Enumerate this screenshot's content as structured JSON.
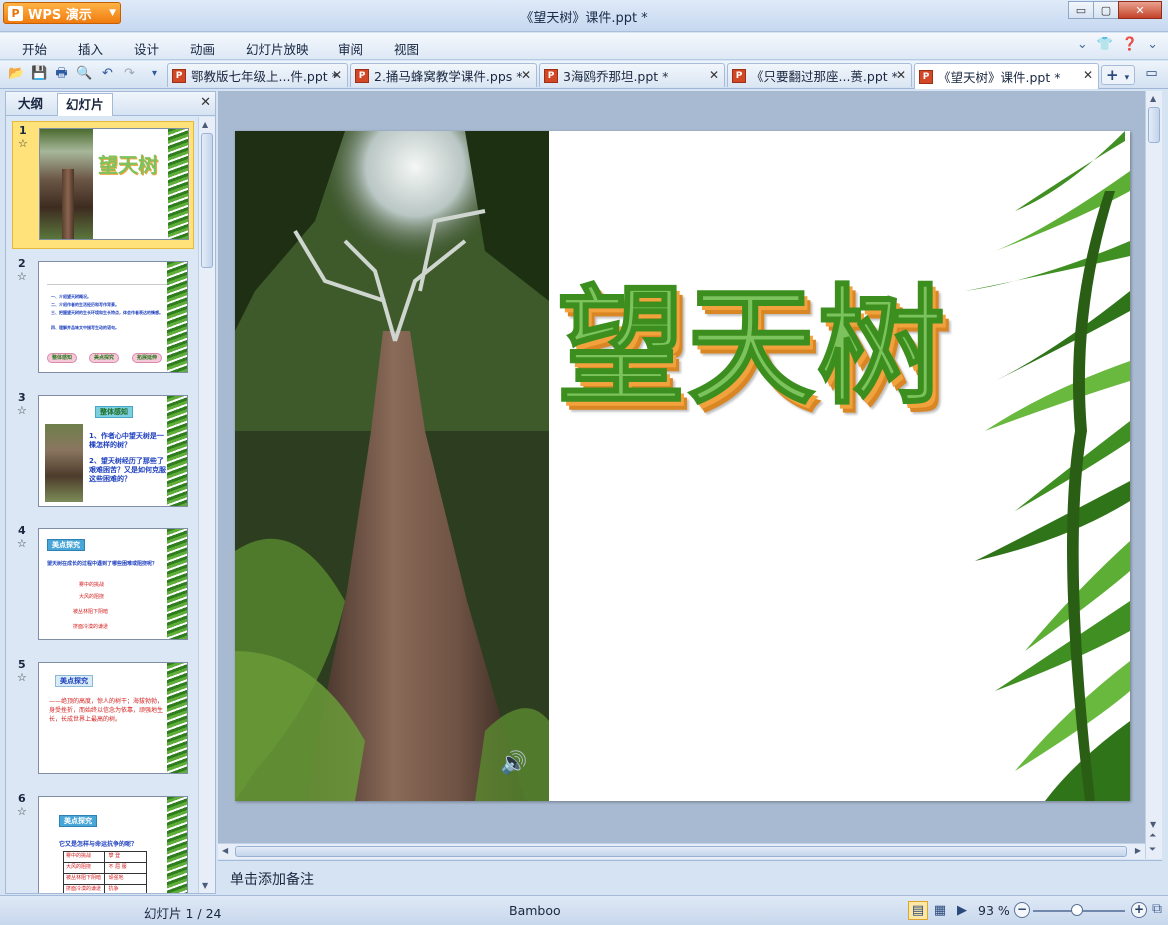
{
  "app": {
    "button_label": "WPS 演示",
    "window_title": "《望天树》课件.ppt *"
  },
  "window_controls": {
    "minimize": "▭",
    "maximize": "▢",
    "close": "✕"
  },
  "menu": [
    "开始",
    "插入",
    "设计",
    "动画",
    "幻灯片放映",
    "审阅",
    "视图"
  ],
  "tabs": [
    {
      "label": "鄂教版七年级上...件.ppt *"
    },
    {
      "label": "2.捅马蜂窝教学课件.pps *"
    },
    {
      "label": "3海鸥乔那坦.ppt *"
    },
    {
      "label": "《只要翻过那座...蒉.ppt *"
    },
    {
      "label": "《望天树》课件.ppt *"
    }
  ],
  "panel": {
    "tab_outline": "大纲",
    "tab_slides": "幻灯片"
  },
  "thumbnails": [
    {
      "num": "1",
      "title": "望天树"
    },
    {
      "num": "2",
      "buttons": [
        "整体感知",
        "美点探究",
        "拓展延伸"
      ],
      "lines": [
        "一、介绍望天树概况。",
        "二、介绍作者的生活经历和写作背景。",
        "三、把握望天树的生长环境和生长特点，体会作者表达的情感。",
        "四、理解并品味文中描写生动的语句。"
      ]
    },
    {
      "num": "3",
      "tag": "整体感知",
      "lines": [
        "1、作者心中望天树是一棵怎样的树？",
        "2、望天树经历了那些了艰难困苦？又是如何克服这些困难的？"
      ]
    },
    {
      "num": "4",
      "tag": "美点探究",
      "question": "望天树在成长的过程中遇到了哪些困难或阻挠呢？",
      "items": [
        "雾中的挑战",
        "大风的阻挠",
        "被丛林阻下阴暗",
        "挤面冷漠的谦逊"
      ]
    },
    {
      "num": "5",
      "tag": "美点探究",
      "text": "——绝顶的高度，惊人的树干；海拔勃勃，身受挫折，而始终以信念为依靠，顽强地生长，长成世界上最高的树。"
    },
    {
      "num": "6",
      "tag": "美点探究",
      "question": "它又是怎样与命运抗争的呢？",
      "table": [
        [
          "雾中的挑战",
          "攀 登"
        ],
        [
          "大风的阻挠",
          "不 屈 服"
        ],
        [
          "被丛林阻下阴暗",
          "顽强地"
        ],
        [
          "挤面冷漠的谦逊",
          "抗争"
        ]
      ]
    }
  ],
  "slide": {
    "title": "望天树"
  },
  "notes_placeholder": "单击添加备注",
  "status": {
    "slide_counter": "幻灯片 1 / 24",
    "theme": "Bamboo",
    "zoom": "93 %"
  },
  "zoom_level_percent": 93,
  "colors": {
    "accent_orange": "#f07b0e",
    "title_green": "#7cc35d",
    "title_orange": "#f2a23c",
    "body_blue": "#1d3fbf",
    "body_red": "#d41f1f"
  },
  "icons": [
    "open-icon",
    "save-icon",
    "print-icon",
    "print-preview-icon",
    "undo-icon",
    "redo-icon",
    "speaker-icon"
  ]
}
